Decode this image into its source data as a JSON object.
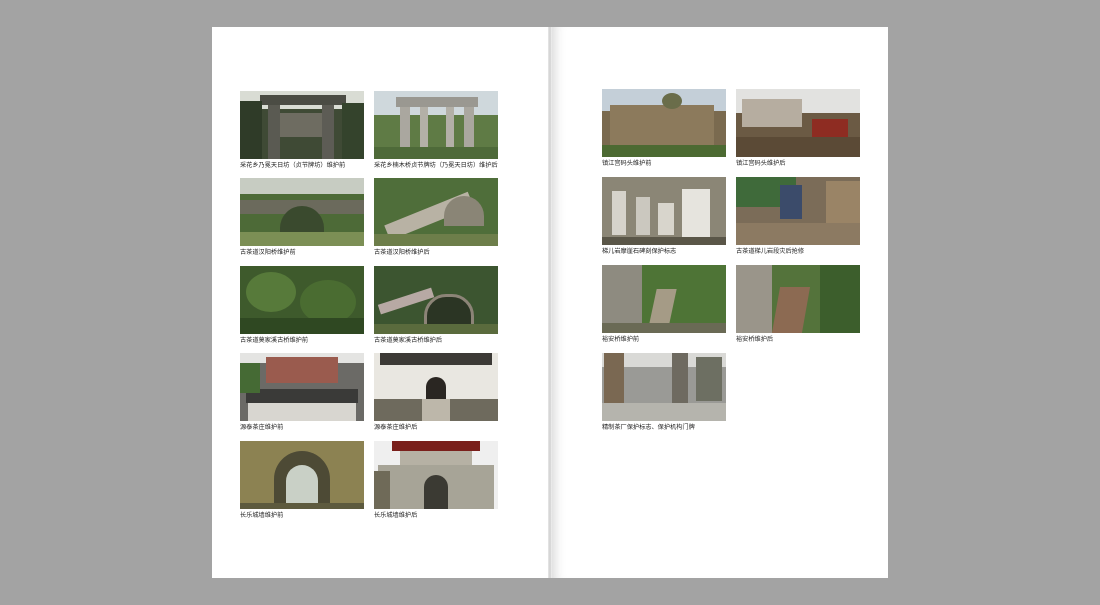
{
  "left_page": {
    "figures": [
      {
        "caption": "采花乡乃冕天日坊（贞节牌坊）维护前",
        "tone": "dark-forest"
      },
      {
        "caption": "采花乡楠木桥贞节牌坊（乃冕天日坊）维护后",
        "tone": "stone-arch"
      },
      {
        "caption": "古茶道汉阳桥维护前",
        "tone": "bridge-old"
      },
      {
        "caption": "古茶道汉阳桥维护后",
        "tone": "bridge-new"
      },
      {
        "caption": "古茶道莫家溪古桥维护前",
        "tone": "jungle"
      },
      {
        "caption": "古茶道莫家溪古桥维护后",
        "tone": "stairs"
      },
      {
        "caption": "源泰茶庄维护前",
        "tone": "village"
      },
      {
        "caption": "源泰茶庄维护后",
        "tone": "white-hall"
      },
      {
        "caption": "长乐城墙维护前",
        "tone": "gate-old"
      },
      {
        "caption": "长乐城墙维护后",
        "tone": "gate-tower"
      }
    ]
  },
  "right_page": {
    "figures": [
      {
        "caption": "镇江宫码头维护前",
        "tone": "ruin"
      },
      {
        "caption": "镇江宫码头维护后",
        "tone": "ruin-sign"
      },
      {
        "caption": "梯儿岩摩崖石碑刻保护标志",
        "tone": "steles"
      },
      {
        "caption": "古茶道梯儿岩段灾后抢修",
        "tone": "worker"
      },
      {
        "caption": "裕安桥维护前",
        "tone": "path-old"
      },
      {
        "caption": "裕安桥维护后",
        "tone": "path-new"
      },
      {
        "caption": "精制茶厂保护标志、保护机构门牌",
        "tone": "factory"
      }
    ]
  },
  "colors": {
    "background": "#a3a3a3",
    "page": "#ffffff",
    "caption": "#222222"
  }
}
